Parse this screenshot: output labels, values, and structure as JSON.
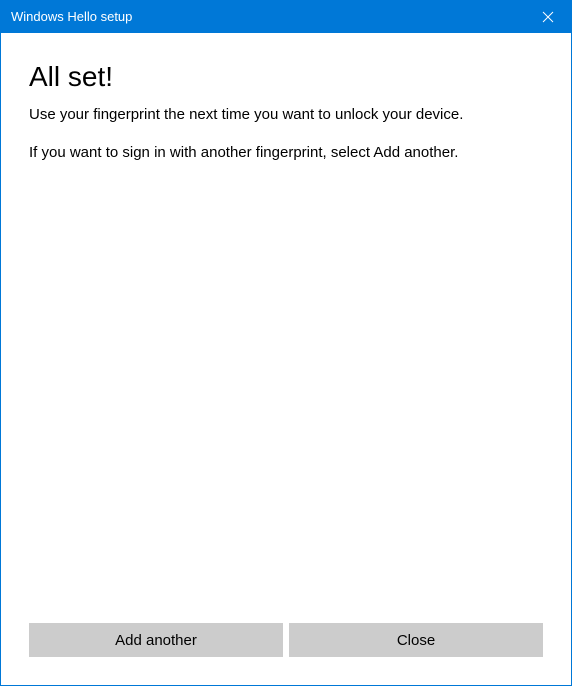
{
  "titlebar": {
    "title": "Windows Hello setup"
  },
  "content": {
    "heading": "All set!",
    "paragraph1": "Use your fingerprint the next time you want to unlock your device.",
    "paragraph2": "If you want to sign in with another fingerprint, select Add another."
  },
  "buttons": {
    "add_another": "Add another",
    "close": "Close"
  }
}
